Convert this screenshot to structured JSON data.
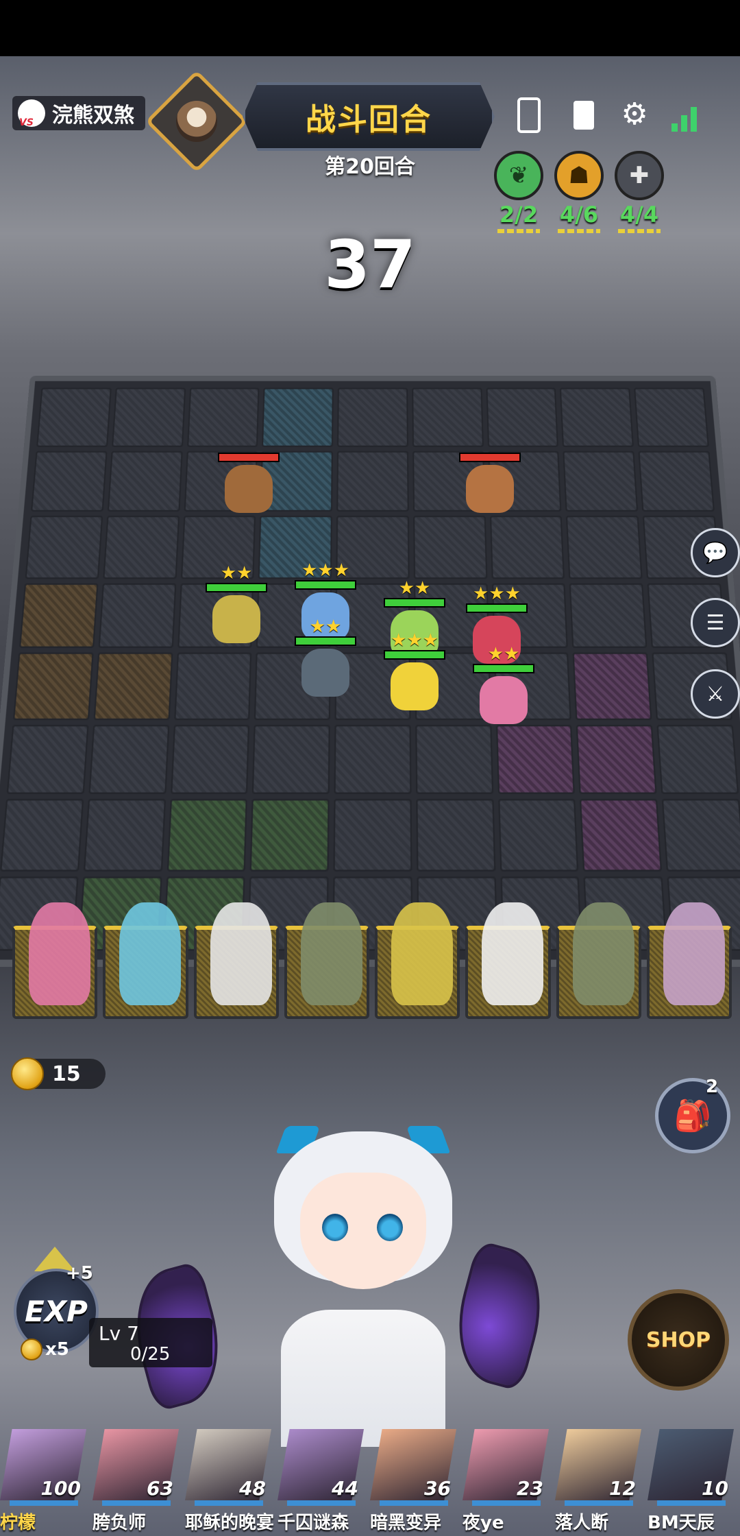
{
  "opponent": {
    "name": "浣熊双煞"
  },
  "phase": {
    "title": "战斗回合",
    "round": "第20回合",
    "countdown": "37"
  },
  "synergies": [
    {
      "count": "2/2",
      "color": "#49b45a",
      "icon": "leaf-icon"
    },
    {
      "count": "4/6",
      "color": "#e3a02a",
      "icon": "hooded-figure-icon"
    },
    {
      "count": "4/4",
      "color": "#4a4d55",
      "icon": "cross-icon"
    }
  ],
  "gold": {
    "value": "15"
  },
  "bag": {
    "count": "2"
  },
  "exp": {
    "label": "EXP",
    "bonus": "+5",
    "cost": "x5",
    "level": "Lv 7",
    "progress": "0/25"
  },
  "shop": {
    "label": "SHOP"
  },
  "players": [
    {
      "name": "柠檬",
      "hp": "100",
      "color": "#c9a3e4"
    },
    {
      "name": "胯负师",
      "hp": "63",
      "color": "#f09aa8"
    },
    {
      "name": "耶稣的晚宴",
      "hp": "48",
      "color": "#d8d0c4"
    },
    {
      "name": "千囚谜森",
      "hp": "44",
      "color": "#b08fd0"
    },
    {
      "name": "暗黑变异",
      "hp": "36",
      "color": "#f1b08a"
    },
    {
      "name": "夜ye",
      "hp": "23",
      "color": "#f5a0b4"
    },
    {
      "name": "落人断",
      "hp": "12",
      "color": "#f6d2a0"
    },
    {
      "name": "BM天辰",
      "hp": "10",
      "color": "#4d5e74"
    }
  ]
}
